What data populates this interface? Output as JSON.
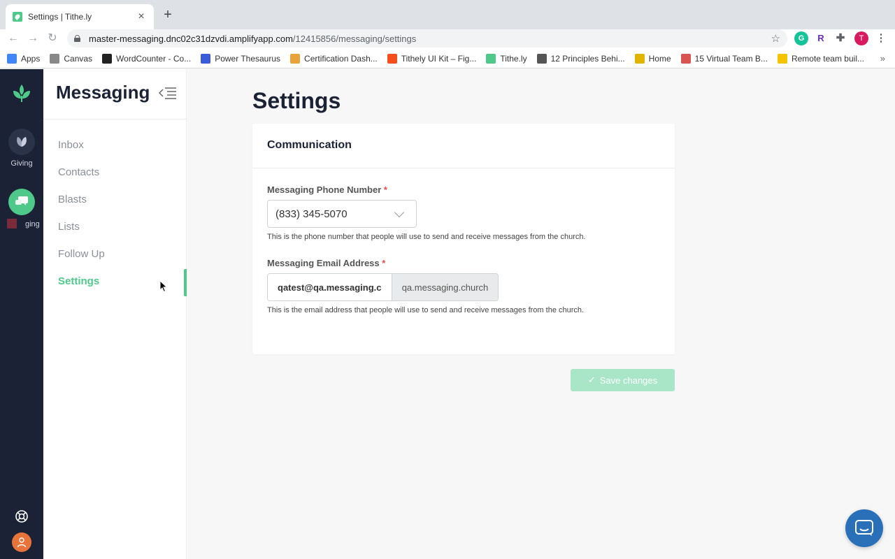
{
  "browser": {
    "tab_title": "Settings | Tithe.ly",
    "tab_close": "×",
    "new_tab": "+",
    "url_host": "master-messaging.dnc02c31dzvdi.amplifyapp.com",
    "url_path": "/12415856/messaging/settings",
    "profile_initial": "T",
    "ext_r": "R",
    "bookmarks": [
      {
        "label": "Apps",
        "icon": "apps-grid-icon",
        "color": "#4285f4"
      },
      {
        "label": "Canvas",
        "icon": "canvas-icon",
        "color": "#888888"
      },
      {
        "label": "WordCounter - Co...",
        "icon": "wordcounter-icon",
        "color": "#222222"
      },
      {
        "label": "Power Thesaurus",
        "icon": "power-thesaurus-icon",
        "color": "#3b5bdb"
      },
      {
        "label": "Certification Dash...",
        "icon": "certification-icon",
        "color": "#e8a33b"
      },
      {
        "label": "Tithely UI Kit – Fig...",
        "icon": "figma-icon",
        "color": "#f24e1e"
      },
      {
        "label": "Tithe.ly",
        "icon": "tithely-icon",
        "color": "#4fc98a"
      },
      {
        "label": "12 Principles Behi...",
        "icon": "principles-icon",
        "color": "#555555"
      },
      {
        "label": "Home",
        "icon": "home-icon",
        "color": "#e0b400"
      },
      {
        "label": "15 Virtual Team B...",
        "icon": "virtual-team-icon",
        "color": "#d9534f"
      },
      {
        "label": "Remote team buil...",
        "icon": "remote-team-icon",
        "color": "#f5c400"
      }
    ],
    "bookmarks_more": "»"
  },
  "rail": {
    "giving_label": "Giving",
    "messaging_label": "ging"
  },
  "sidebar": {
    "title": "Messaging",
    "items": [
      {
        "label": "Inbox",
        "active": false
      },
      {
        "label": "Contacts",
        "active": false
      },
      {
        "label": "Blasts",
        "active": false
      },
      {
        "label": "Lists",
        "active": false
      },
      {
        "label": "Follow Up",
        "active": false
      },
      {
        "label": "Settings",
        "active": true
      }
    ]
  },
  "main": {
    "page_title": "Settings",
    "card_title": "Communication",
    "phone": {
      "label": "Messaging Phone Number",
      "required_mark": "*",
      "value": "(833) 345-5070",
      "help": "This is the phone number that people will use to send and receive messages from the church."
    },
    "email": {
      "label": "Messaging Email Address",
      "required_mark": "*",
      "value": "qatest@qa.messaging.church",
      "suffix": "qa.messaging.church",
      "help": "This is the email address that people will use to send and receive messages from the church."
    },
    "save_label": "Save changes",
    "save_check": "✓"
  },
  "colors": {
    "brand_green": "#4fc98a",
    "rail_bg": "#1b2235",
    "chat_blue": "#2a70b8"
  }
}
